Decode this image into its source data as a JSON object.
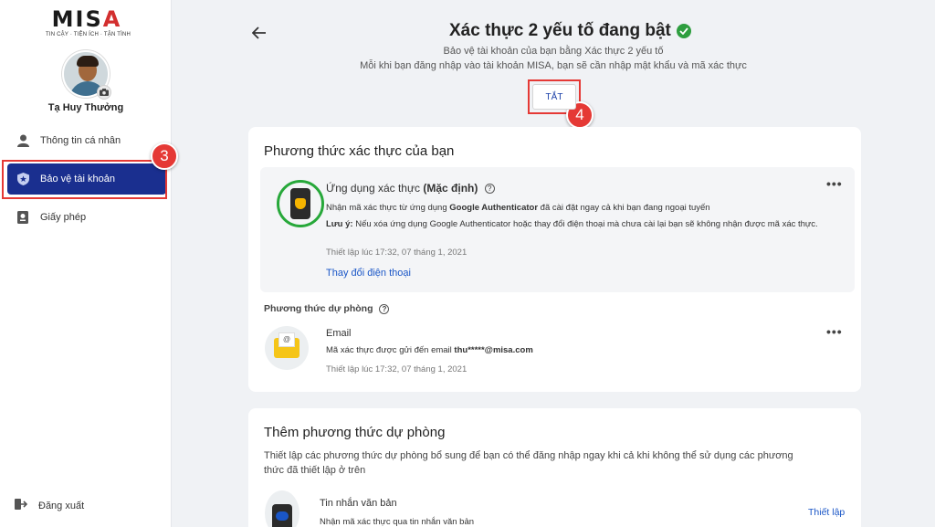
{
  "sidebar": {
    "logo_text": "MISA",
    "logo_tagline": "TIN CẬY · TIỆN ÍCH · TẬN TÌNH",
    "user_name": "Tạ Huy Thưởng",
    "items": [
      {
        "label": "Thông tin cá nhân",
        "icon": "person-icon"
      },
      {
        "label": "Bảo vệ tài khoản",
        "icon": "shield-star-icon",
        "active": true
      },
      {
        "label": "Giấy phép",
        "icon": "license-icon"
      }
    ],
    "logout_label": "Đăng xuất"
  },
  "annotations": {
    "step3": "3",
    "step4": "4",
    "color": "#e53935"
  },
  "header": {
    "title": "Xác thực 2 yếu tố đang bật",
    "subtitle_1": "Bảo vệ tài khoản của bạn bằng Xác thực 2 yếu tố",
    "subtitle_2": "Mỗi khi bạn đăng nhập vào tài khoản MISA, bạn sẽ cần nhập mật khẩu và mã xác thực",
    "off_button": "TẮT"
  },
  "methods_card": {
    "title": "Phương thức xác thực của bạn",
    "primary": {
      "name": "Ứng dụng xác thực",
      "default_tag": "(Mặc định)",
      "desc_prefix": "Nhận mã xác thực từ ứng dụng",
      "desc_app": "Google Authenticator",
      "desc_suffix": "đã cài đặt ngay cả khi bạn đang ngoại tuyến",
      "note_label": "Lưu ý:",
      "note_text": "Nếu xóa ứng dụng Google Authenticator hoặc thay đổi điện thoại mà chưa cài lại bạn sẽ không nhận được mã xác thực.",
      "setup_time": "Thiết lập lúc 17:32, 07 tháng 1, 2021",
      "change_link": "Thay đổi điện thoại",
      "more": "•••"
    },
    "backup_title": "Phương thức dự phòng",
    "backup": {
      "name": "Email",
      "desc_prefix": "Mã xác thực được gửi đến email",
      "email": "thu*****@misa.com",
      "setup_time": "Thiết lập lúc 17:32, 07 tháng 1, 2021",
      "more": "•••"
    }
  },
  "add_card": {
    "title": "Thêm phương thức dự phòng",
    "desc_1": "Thiết lập các phương thức dự phòng bổ sung để bạn có thể đăng nhập ngay khi cả khi không thể sử dụng các phương",
    "desc_2": "thức đã thiết lập ở trên",
    "sms_name": "Tin nhắn văn bản",
    "sms_desc": "Nhận mã xác thực qua tin nhắn văn bản",
    "setup_link": "Thiết lập"
  }
}
